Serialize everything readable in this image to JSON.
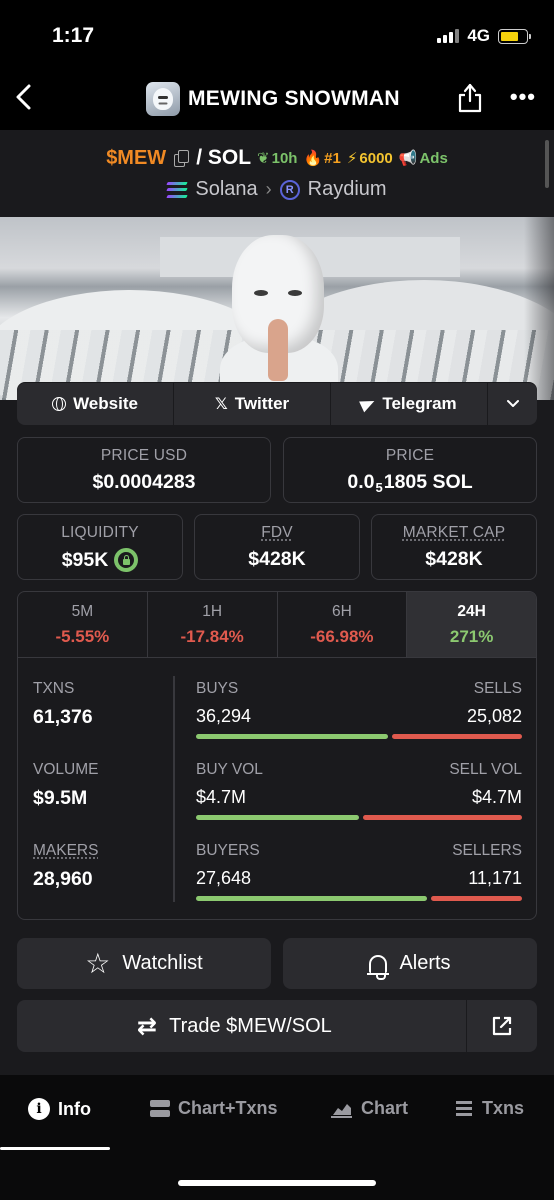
{
  "status": {
    "time": "1:17",
    "network": "4G"
  },
  "header": {
    "title": "MEWING SNOWMAN",
    "back_icon": "chevron-left-icon",
    "share_icon": "share-icon",
    "more_icon": "more-icon"
  },
  "pair": {
    "base": "$MEW",
    "separator": "/ SOL",
    "age": "10h",
    "rank": "#1",
    "boost": "6000",
    "ads": "Ads",
    "chain": "Solana",
    "dex": "Raydium"
  },
  "links": {
    "website": "Website",
    "twitter": "Twitter",
    "telegram": "Telegram"
  },
  "stats": {
    "price_usd_label": "PRICE USD",
    "price_usd": "$0.0004283",
    "price_label": "PRICE",
    "price_main": "0.0",
    "price_sub": "5",
    "price_rest": "1805 SOL",
    "liquidity_label": "LIQUIDITY",
    "liquidity": "$95K",
    "fdv_label": "FDV",
    "fdv": "$428K",
    "mcap_label": "MARKET CAP",
    "mcap": "$428K"
  },
  "timeframes": [
    {
      "name": "5M",
      "change": "-5.55%"
    },
    {
      "name": "1H",
      "change": "-17.84%"
    },
    {
      "name": "6H",
      "change": "-66.98%"
    },
    {
      "name": "24H",
      "change": "271%"
    }
  ],
  "metrics": {
    "txns_label": "TXNS",
    "txns": "61,376",
    "volume_label": "VOLUME",
    "volume": "$9.5M",
    "makers_label": "MAKERS",
    "makers": "28,960"
  },
  "splits": {
    "buys_label": "BUYS",
    "buys": "36,294",
    "sells_label": "SELLS",
    "sells": "25,082",
    "buys_share": 0.59,
    "buyvol_label": "BUY VOL",
    "buyvol": "$4.7M",
    "sellvol_label": "SELL VOL",
    "sellvol": "$4.7M",
    "buyvol_share": 0.5,
    "buyers_label": "BUYERS",
    "buyers": "27,648",
    "sellers_label": "SELLERS",
    "sellers": "11,171",
    "buyers_share": 0.71
  },
  "actions": {
    "watchlist": "Watchlist",
    "alerts": "Alerts",
    "trade": "Trade $MEW/SOL"
  },
  "bottom_nav": {
    "info": "Info",
    "chart_txns": "Chart+Txns",
    "chart": "Chart",
    "txns": "Txns"
  },
  "colors": {
    "accent_orange": "#f08a24",
    "positive": "#8cc970",
    "negative": "#e05a4e"
  }
}
